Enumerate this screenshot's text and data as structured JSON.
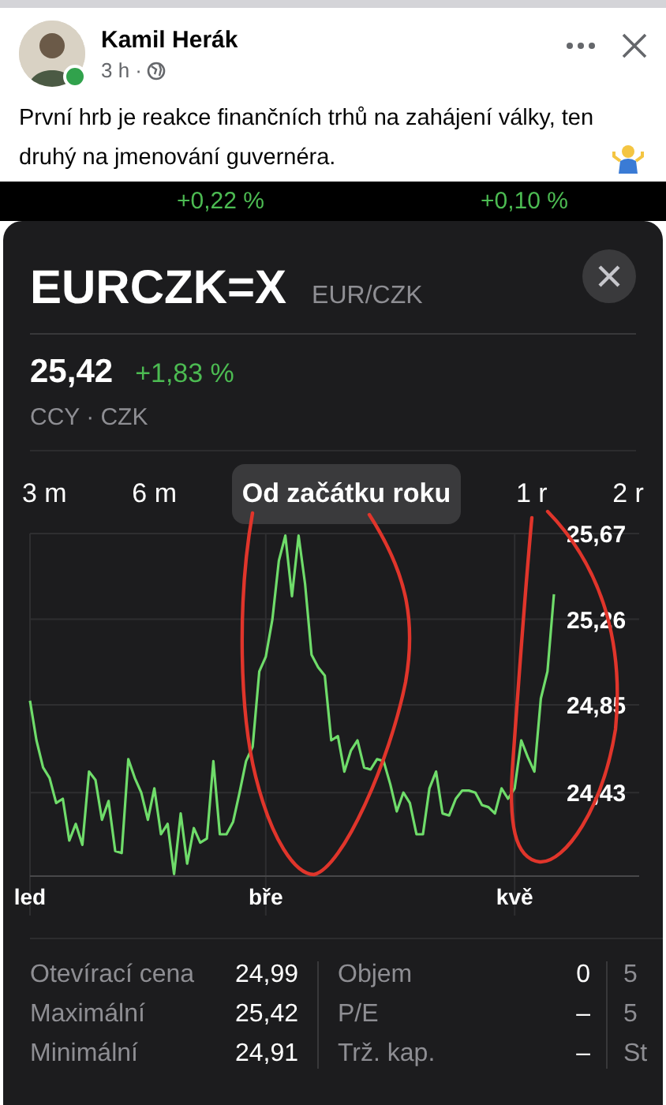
{
  "post": {
    "author": "Kamil Herák",
    "time": "3 h ·",
    "online": true,
    "text": "První hrb je reakce finančních trhů na zahájení války, ten druhý na jmenování guvernéra."
  },
  "background_quotes": [
    "+0,22 %",
    "+0,10 %"
  ],
  "quote": {
    "symbol": "EURCZK=X",
    "pair": "EUR/CZK",
    "price": "25,42",
    "change": "+1,83 %",
    "exchange": "CCY · CZK"
  },
  "ranges": [
    {
      "label": "3 m",
      "selected": false
    },
    {
      "label": "6 m",
      "selected": false
    },
    {
      "label": "Od začátku roku",
      "selected": true
    },
    {
      "label": "1 r",
      "selected": false
    },
    {
      "label": "2 r",
      "selected": false
    }
  ],
  "chart": {
    "chart_data": {
      "type": "line",
      "grid": true,
      "ylim": [
        24.03,
        25.67
      ],
      "categories": [
        "led",
        null,
        null,
        null,
        null,
        null,
        null,
        null,
        null,
        null,
        null,
        null,
        null,
        null,
        null,
        null,
        null,
        null,
        null,
        null,
        null,
        null,
        null,
        null,
        null,
        null,
        null,
        null,
        null,
        null,
        null,
        null,
        null,
        null,
        null,
        null,
        "bře",
        null,
        null,
        null,
        null,
        null,
        null,
        null,
        null,
        null,
        null,
        null,
        null,
        null,
        null,
        null,
        null,
        null,
        null,
        null,
        null,
        null,
        null,
        null,
        null,
        null,
        null,
        null,
        null,
        null,
        null,
        null,
        null,
        null,
        null,
        null,
        null,
        null,
        "kvě",
        null,
        null,
        null,
        null,
        null,
        null
      ],
      "yticks": [
        {
          "value": 25.67,
          "label": "25,67"
        },
        {
          "value": 25.26,
          "label": "25,26"
        },
        {
          "value": 24.85,
          "label": "24,85"
        },
        {
          "value": 24.43,
          "label": "24,43"
        }
      ],
      "series": [
        {
          "color": "#6fdc6a",
          "values": [
            24.87,
            24.68,
            24.55,
            24.5,
            24.38,
            24.4,
            24.2,
            24.28,
            24.18,
            24.53,
            24.49,
            24.3,
            24.39,
            24.15,
            24.14,
            24.59,
            24.5,
            24.43,
            24.3,
            24.45,
            24.23,
            24.28,
            24.04,
            24.33,
            24.09,
            24.26,
            24.19,
            24.21,
            24.58,
            24.23,
            24.23,
            24.29,
            24.43,
            24.58,
            24.65,
            25.01,
            25.08,
            25.26,
            25.54,
            25.66,
            25.37,
            25.66,
            25.43,
            25.09,
            25.03,
            24.99,
            24.68,
            24.7,
            24.53,
            24.63,
            24.68,
            24.55,
            24.54,
            24.59,
            24.58,
            24.47,
            24.34,
            24.43,
            24.38,
            24.23,
            24.23,
            24.45,
            24.53,
            24.33,
            24.32,
            24.4,
            24.44,
            24.44,
            24.43,
            24.37,
            24.36,
            24.33,
            24.45,
            24.4,
            24.45,
            24.68,
            24.6,
            24.53,
            24.88,
            25.01,
            25.38
          ]
        }
      ]
    }
  },
  "stats": [
    [
      {
        "label": "Otevírací cena",
        "value": "24,99"
      },
      {
        "label": "Maximální",
        "value": "25,42"
      },
      {
        "label": "Minimální",
        "value": "24,91"
      }
    ],
    [
      {
        "label": "Objem",
        "value": "0"
      },
      {
        "label": "P/E",
        "value": "–"
      },
      {
        "label": "Trž. kap.",
        "value": "–"
      }
    ],
    [
      {
        "label": "5"
      },
      {
        "label": "5"
      },
      {
        "label": "St"
      }
    ]
  ]
}
